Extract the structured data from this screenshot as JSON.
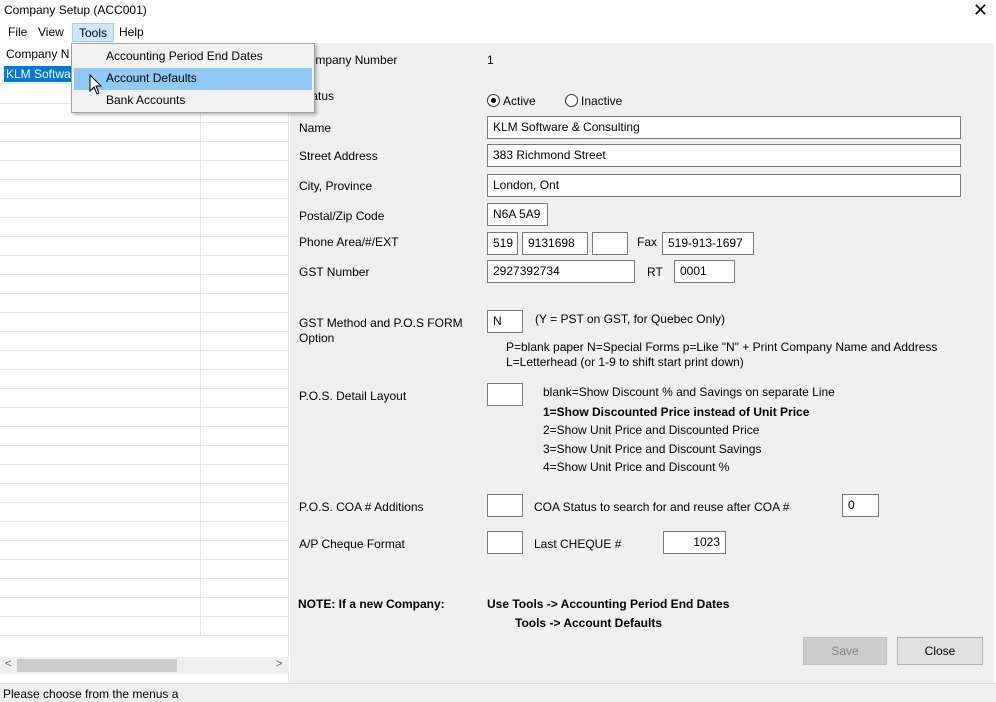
{
  "window": {
    "title": "Company Setup (ACC001)"
  },
  "menubar": {
    "items": [
      "File",
      "View",
      "Tools",
      "Help"
    ]
  },
  "tools_menu": {
    "items": [
      "Accounting Period End Dates",
      "Account Defaults",
      "Bank Accounts"
    ],
    "highlighted": "Account Defaults"
  },
  "left_list": {
    "header": "Company N",
    "selected_row": "KLM Softwa"
  },
  "form": {
    "company_number_label": "Company Number",
    "company_number_value": "1",
    "status_label": "Status",
    "status_active": "Active",
    "status_inactive": "Inactive",
    "name_label": "Name",
    "name_value": "KLM Software & Consulting",
    "street_label": "Street Address",
    "street_value": "383 Richmond Street",
    "city_label": "City, Province",
    "city_value": "London, Ont",
    "postal_label": "Postal/Zip Code",
    "postal_value": "N6A 5A9",
    "phone_label": "Phone Area/#/EXT",
    "phone_area": "519",
    "phone_number": "9131698",
    "phone_ext": "",
    "fax_label": "Fax",
    "fax_value": "519-913-1697",
    "gst_label": "GST Number",
    "gst_value": "2927392734",
    "rt_label": "RT",
    "rt_value": "0001",
    "gst_method_label_1": "GST Method and P.O.S FORM",
    "gst_method_label_2": "Option",
    "gst_method_value": "N",
    "gst_method_hint": "(Y = PST on GST, for Quebec Only)",
    "gst_method_note_1": "P=blank paper     N=Special Forms      p=Like \"N\" + Print Company Name and  Address",
    "gst_method_note_2": "L=Letterhead (or 1-9 to shift start print down)",
    "pos_detail_label": "P.O.S. Detail Layout",
    "pos_detail_value": "",
    "pos_opt_blank": "blank=Show Discount % and Savings on separate Line",
    "pos_opt_1": "1=Show Discounted Price instead of Unit Price",
    "pos_opt_2": "2=Show Unit Price and Discounted Price",
    "pos_opt_3": "3=Show Unit Price and Discount Savings",
    "pos_opt_4": "4=Show Unit Price and Discount %",
    "coa_label": "P.O.S. COA # Additions",
    "coa_value": "",
    "coa_status_label": "COA Status to search for and reuse after COA #",
    "coa_status_value": "0",
    "ap_label": "A/P Cheque Format",
    "ap_value": "",
    "last_cheque_label": "Last CHEQUE #",
    "last_cheque_value": "1023",
    "note_label": "NOTE:  If a new Company:",
    "note_line_1": "Use Tools -> Accounting Period End Dates",
    "note_line_2": "Tools -> Account Defaults"
  },
  "buttons": {
    "save": "Save",
    "close": "Close"
  },
  "statusbar": {
    "text": "Please choose from the menus a"
  }
}
